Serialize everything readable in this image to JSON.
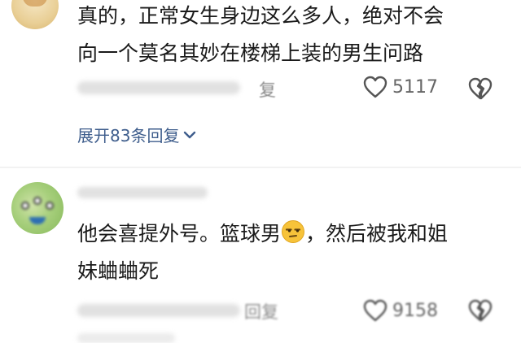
{
  "comments": [
    {
      "lines": [
        "真的，正常女生身边这么多人，绝对不会",
        "向一个莫名其妙在楼梯上装的男生问路"
      ],
      "reply_label": "复",
      "like_count": "5117",
      "expand_replies": "展开83条回复"
    },
    {
      "line1_before_emoji": "他会喜提外号。篮球男",
      "line1_after_emoji": "，然后被我和姐",
      "line2": "妹蛐蛐死",
      "reply_label": "回复",
      "like_count": "9158"
    }
  ],
  "colors": {
    "accent_link": "#3e5d8c",
    "muted": "#8a8a8a"
  },
  "icons": [
    "heart-outline-icon",
    "broken-heart-icon",
    "chevron-down-icon",
    "unamused-face-emoji"
  ]
}
